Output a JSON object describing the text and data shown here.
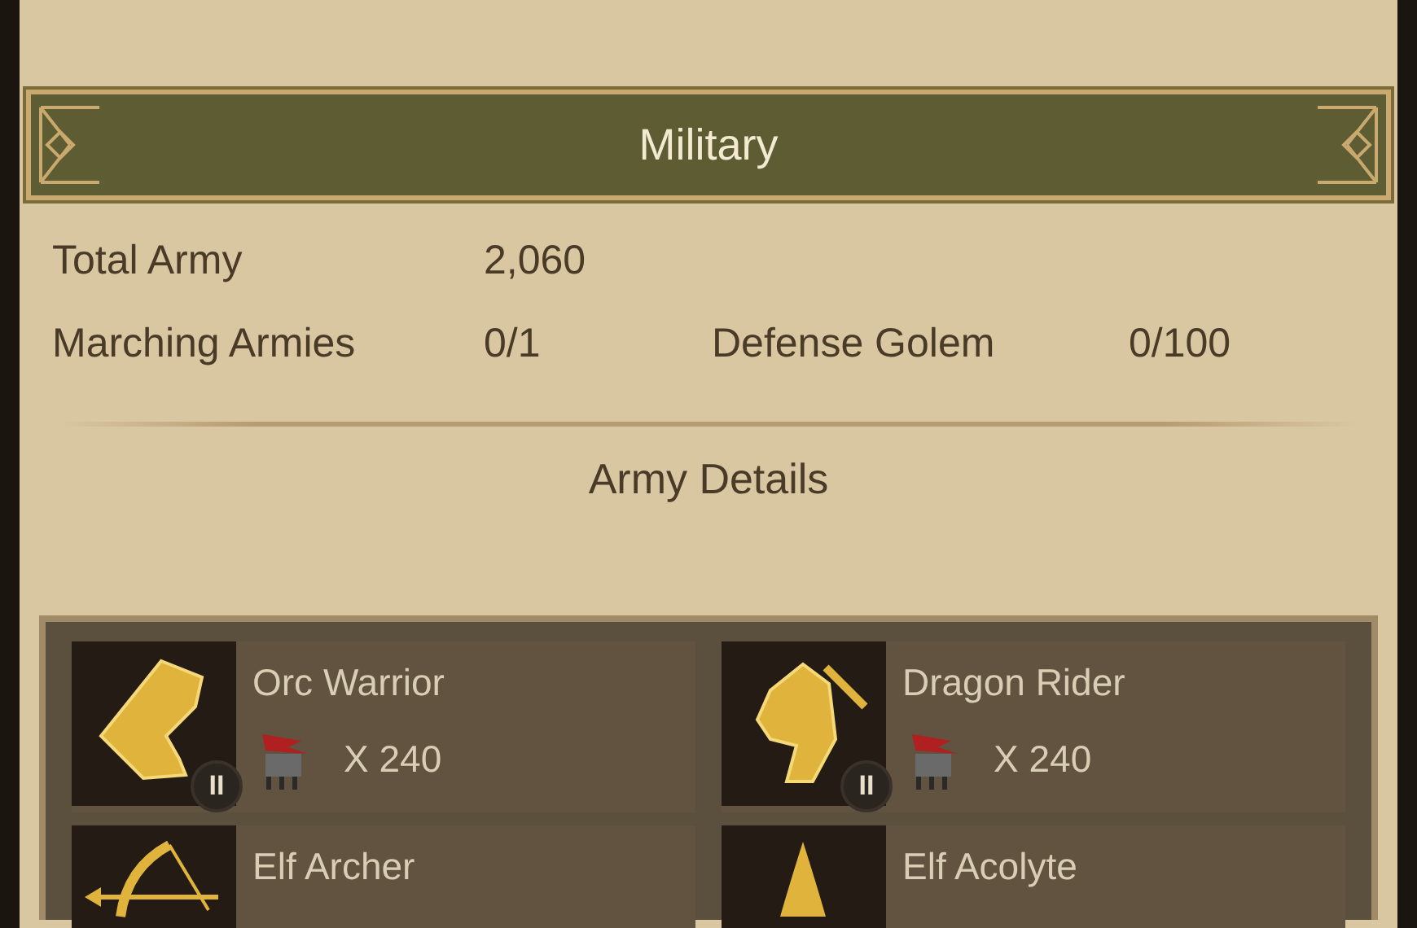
{
  "header": {
    "title": "Military"
  },
  "stats": [
    {
      "label": "Total Army",
      "value": "2,060"
    },
    {
      "label": "Marching Armies",
      "value": "0/1",
      "label_2": "Defense Golem",
      "value_2": "0/100"
    }
  ],
  "section_title": "Army Details",
  "units": [
    {
      "name": "Orc Warrior",
      "tier": "II",
      "count": "X 240"
    },
    {
      "name": "Dragon Rider",
      "tier": "II",
      "count": "X 240"
    },
    {
      "name": "Elf Archer"
    },
    {
      "name": "Elf Acolyte"
    }
  ]
}
